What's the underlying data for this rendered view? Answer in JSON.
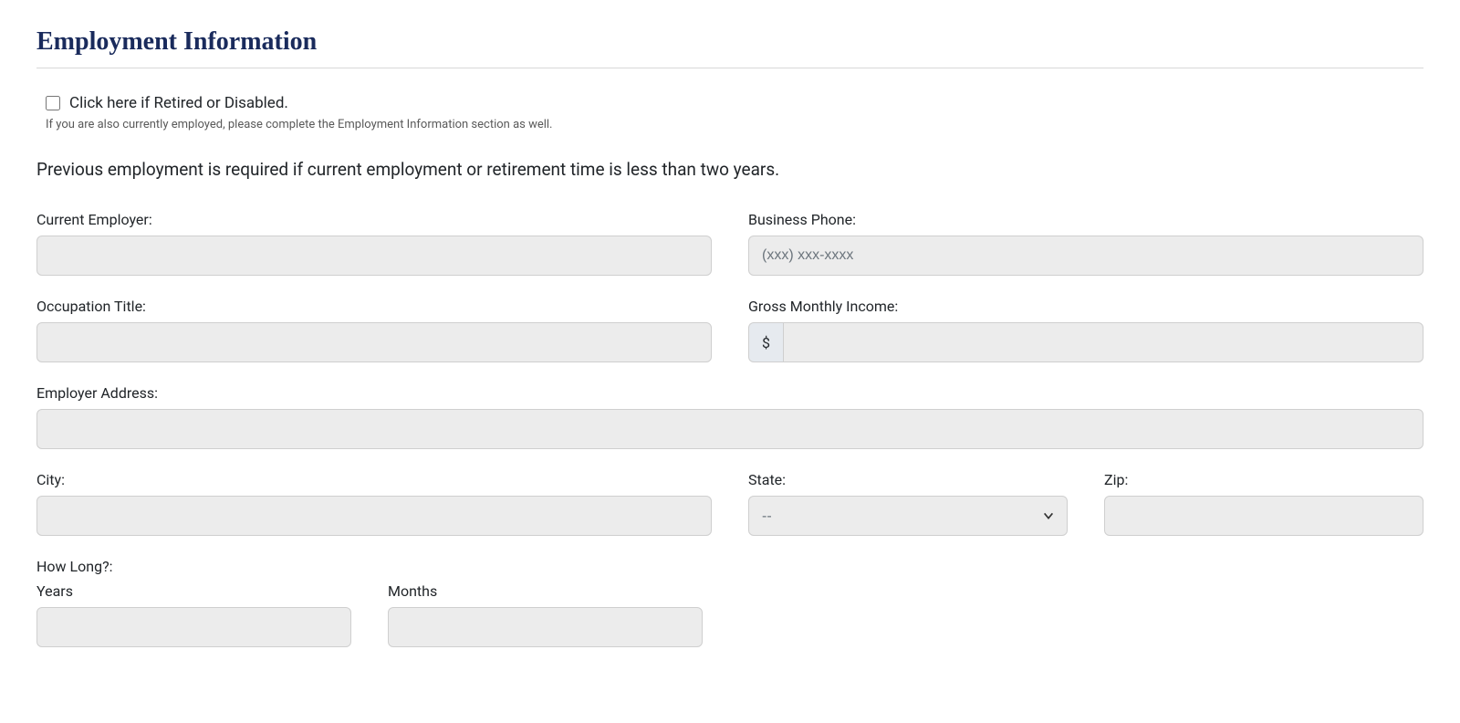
{
  "section": {
    "title": "Employment Information"
  },
  "checkbox": {
    "label": "Click here if Retired or Disabled.",
    "helper": "If you are also currently employed, please complete the Employment Information section as well."
  },
  "instruction": "Previous employment is required if current employment or retirement time is less than two years.",
  "fields": {
    "currentEmployer": {
      "label": "Current Employer:"
    },
    "businessPhone": {
      "label": "Business Phone:",
      "placeholder": "(xxx) xxx-xxxx"
    },
    "occupationTitle": {
      "label": "Occupation Title:"
    },
    "grossMonthlyIncome": {
      "label": "Gross Monthly Income:",
      "addon": "$"
    },
    "employerAddress": {
      "label": "Employer Address:"
    },
    "city": {
      "label": "City:"
    },
    "state": {
      "label": "State:",
      "selected": "--"
    },
    "zip": {
      "label": "Zip:"
    },
    "howLong": {
      "label": "How Long?:",
      "years": "Years",
      "months": "Months"
    }
  }
}
